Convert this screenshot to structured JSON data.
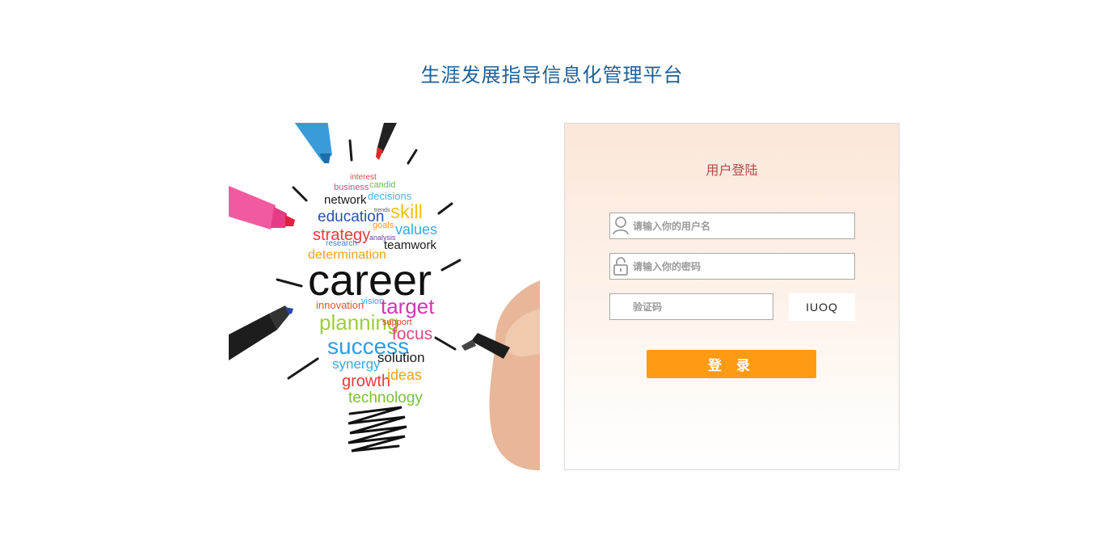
{
  "page": {
    "title": "生涯发展指导信息化管理平台"
  },
  "illustration": {
    "words": {
      "interest": "interest",
      "business": "business",
      "candid": "candid",
      "network": "network",
      "decisions": "decisions",
      "trends": "trends",
      "skill": "skill",
      "education": "education",
      "strategy": "strategy",
      "goals": "goals",
      "values": "values",
      "research": "research",
      "analysis": "analysis",
      "teamwork": "teamwork",
      "determination": "determination",
      "career": "career",
      "innovation": "innovation",
      "vision": "vision",
      "target": "target",
      "planning": "planning",
      "support": "support",
      "success": "success",
      "focus": "focus",
      "synergy": "synergy",
      "solution": "solution",
      "growth": "growth",
      "ideas": "ideas",
      "technology": "technology"
    }
  },
  "login": {
    "title": "用户登陆",
    "username_placeholder": "请输入你的用户名",
    "password_placeholder": "请输入你的密码",
    "captcha_placeholder": "验证码",
    "captcha_code": "IUOQ",
    "submit_label": "登 录"
  },
  "colors": {
    "title": "#1d5f97",
    "login_title": "#b24a4a",
    "button": "#ff9a15"
  },
  "icons": {
    "username": "user-icon",
    "password": "lock-icon"
  }
}
